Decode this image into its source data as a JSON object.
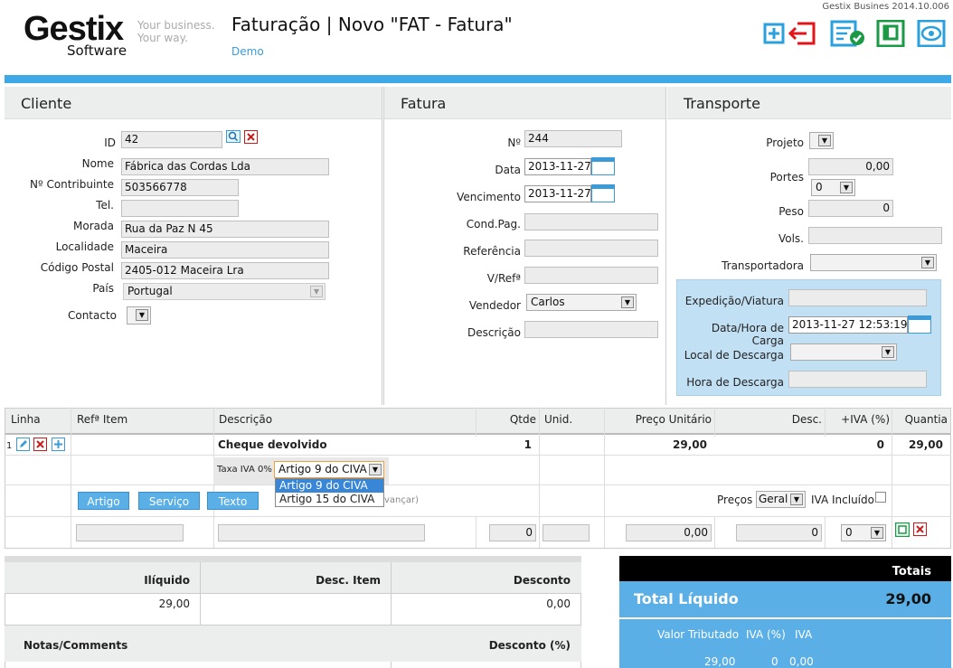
{
  "app": {
    "logo": "Gestix",
    "logo_sub": "Software",
    "tagline_1": "Your business.",
    "tagline_2": "Your way.",
    "title": "Faturação | Novo \"FAT - Fatura\"",
    "demo": "Demo",
    "version": "Gestix Busines 2014.10.006"
  },
  "toolbar": {
    "icons": [
      "new-doc-icon",
      "back-icon",
      "validate-icon",
      "save-icon",
      "preview-icon"
    ]
  },
  "cliente": {
    "header": "Cliente",
    "id_label": "ID",
    "id": "42",
    "nome_label": "Nome",
    "nome": "Fábrica das Cordas Lda",
    "nif_label": "Nº Contribuinte",
    "nif": "503566778",
    "tel_label": "Tel.",
    "tel": "",
    "morada_label": "Morada",
    "morada": "Rua da Paz N 45",
    "localidade_label": "Localidade",
    "localidade": "Maceira",
    "cp_label": "Código Postal",
    "cp": "2405-012 Maceira Lra",
    "pais_label": "País",
    "pais": "Portugal",
    "contacto_label": "Contacto"
  },
  "fatura": {
    "header": "Fatura",
    "num_label": "Nº",
    "num": "244",
    "data_label": "Data",
    "data": "2013-11-27",
    "venc_label": "Vencimento",
    "venc": "2013-11-27",
    "cond_label": "Cond.Pag.",
    "ref_label": "Referência",
    "vref_label": "V/Refª",
    "vendedor_label": "Vendedor",
    "vendedor": "Carlos",
    "descr_label": "Descrição"
  },
  "transporte": {
    "header": "Transporte",
    "projeto_label": "Projeto",
    "portes_label": "Portes",
    "portes": "0,00",
    "portes_sel": "0",
    "peso_label": "Peso",
    "peso": "0",
    "vols_label": "Vols.",
    "transp_label": "Transportadora",
    "exped_label": "Expedição/Viatura",
    "carga_label": "Data/Hora de Carga",
    "carga": "2013-11-27 12:53:19",
    "local_label": "Local de Descarga",
    "hora_label": "Hora de Descarga"
  },
  "grid": {
    "headers": [
      "Linha",
      "Refª Item",
      "Descrição",
      "Qtde",
      "Unid.",
      "Preço Unitário",
      "Desc.",
      "+IVA (%)",
      "Quantia"
    ],
    "row": {
      "linha": "1",
      "descricao": "Cheque devolvido",
      "qtde": "1",
      "preco": "29,00",
      "iva": "0",
      "quantia": "29,00"
    },
    "taxa_label": "Taxa IVA 0%",
    "taxa_selected": "Artigo 9 do CIVA",
    "taxa_options": [
      "Artigo 9 do CIVA",
      "Artigo 15 do CIVA"
    ],
    "btn_artigo": "Artigo",
    "btn_servico": "Serviço",
    "btn_texto": "Texto",
    "hint_tail": "vançar)",
    "precos_label": "Preços",
    "precos": "Geral",
    "iva_incl": "IVA Incluído",
    "new_qtde": "0",
    "new_preco": "0,00",
    "new_desc": "0",
    "new_iva": "0"
  },
  "summary": {
    "iliquido_label": "Ilíquido",
    "iliquido": "29,00",
    "desc_item_label": "Desc. Item",
    "desconto_label": "Desconto",
    "desconto": "0,00",
    "notas_label": "Notas/Comments",
    "desc_pct_label": "Desconto (%)"
  },
  "totals": {
    "header": "Totais",
    "total_label": "Total Líquido",
    "total": "29,00",
    "col1": "Valor Tributado",
    "col2": "IVA (%)",
    "col3": "IVA",
    "v1": "29,00",
    "v2": "0",
    "v3": "0,00"
  },
  "colors": {
    "accent": "#3fa9e8",
    "header_bg": "#eceded",
    "totals_bg": "#5aafe6"
  }
}
